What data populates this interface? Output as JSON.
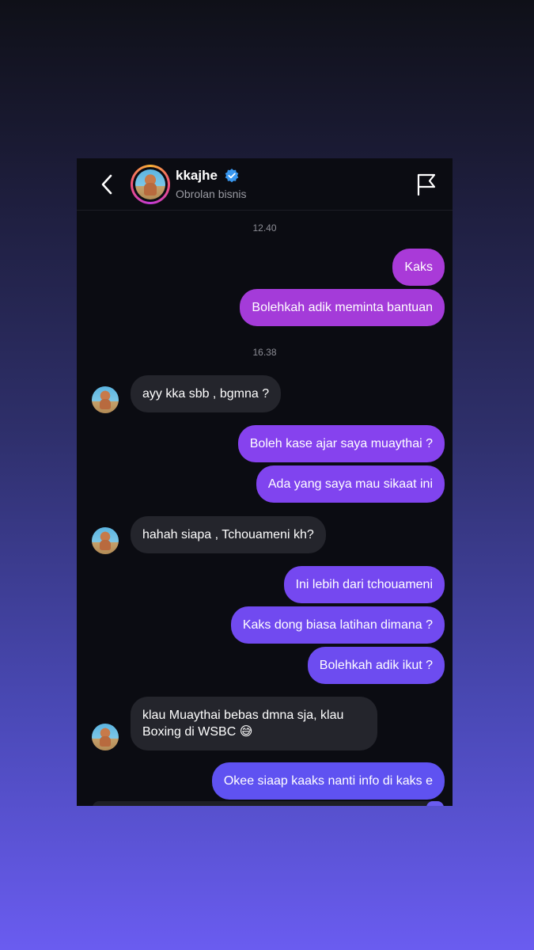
{
  "header": {
    "username": "kkajhe",
    "subtitle": "Obrolan bisnis",
    "icons": [
      "back-chevron-icon",
      "verified-badge-icon",
      "flag-icon"
    ]
  },
  "colors": {
    "accent_top": "#a93ad8",
    "accent_mid": "#7d44f0",
    "accent_bottom": "#5c54f2",
    "incoming_bubble": "#24252c",
    "background": "#0b0c12"
  },
  "timestamps": [
    "12.40",
    "16.38"
  ],
  "messages": {
    "m1": "Kaks",
    "m2": "Bolehkah adik meminta bantuan",
    "m3": "ayy kka sbb , bgmna ?",
    "m4": "Boleh kase ajar saya muaythai ?",
    "m5": "Ada yang saya mau sikaat ini",
    "m6": "hahah siapa , Tchouameni kh?",
    "m7": "Ini lebih dari tchouameni",
    "m8": "Kaks dong biasa latihan dimana ?",
    "m9": "Bolehkah adik ikut ?",
    "m10": "klau Muaythai bebas dmna sja, klau Boxing di WSBC 😅",
    "m11": "Okee siaap kaaks nanti info di kaks e"
  }
}
